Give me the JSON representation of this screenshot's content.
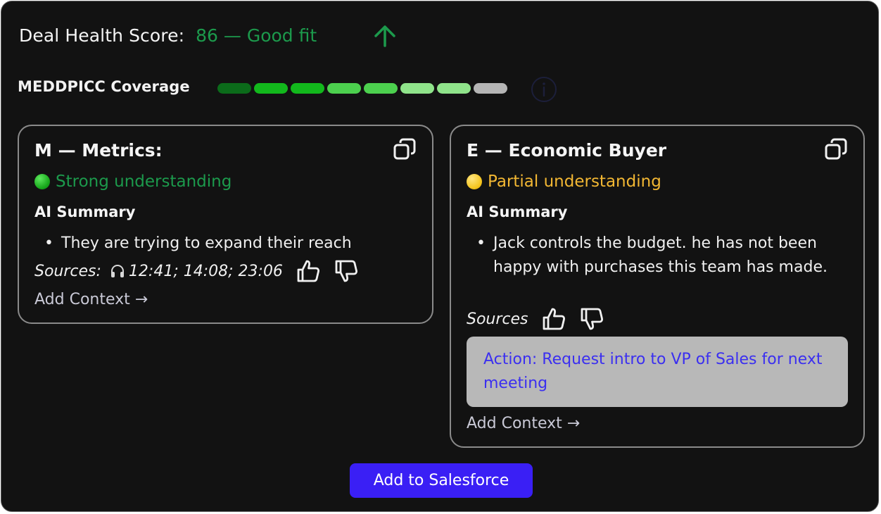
{
  "header": {
    "score_label": "Deal Health Score:",
    "score_value": "86 — Good fit",
    "trend_icon": "arrow-up-icon"
  },
  "coverage": {
    "label": "MEDDPICC Coverage",
    "segments": [
      {
        "color": "#0b6b1a"
      },
      {
        "color": "#12b81c"
      },
      {
        "color": "#12b81c"
      },
      {
        "color": "#4cd04e"
      },
      {
        "color": "#4cd04e"
      },
      {
        "color": "#8fe38a"
      },
      {
        "color": "#8fe38a"
      },
      {
        "color": "#b5b5b5"
      }
    ],
    "info_icon": "info-icon"
  },
  "cards": [
    {
      "title": "M — Metrics:",
      "status": "Strong understanding",
      "status_color": "#1c9a4c",
      "summary_label": "AI Summary",
      "bullets": [
        "They are trying to expand their reach"
      ],
      "sources_label": "Sources:",
      "sources_times": "12:41; 14:08; 23:06",
      "add_context": "Add Context →"
    },
    {
      "title": "E — Economic Buyer",
      "status": "Partial understanding",
      "status_color": "#f2b733",
      "summary_label": "AI Summary",
      "bullets": [
        "Jack controls the budget. he has not been happy with purchases this team has made."
      ],
      "sources_label": "Sources",
      "action": "Action: Request intro to VP of Sales for next meeting",
      "add_context": "Add Context →"
    }
  ],
  "footer": {
    "button_label": "Add to Salesforce"
  }
}
